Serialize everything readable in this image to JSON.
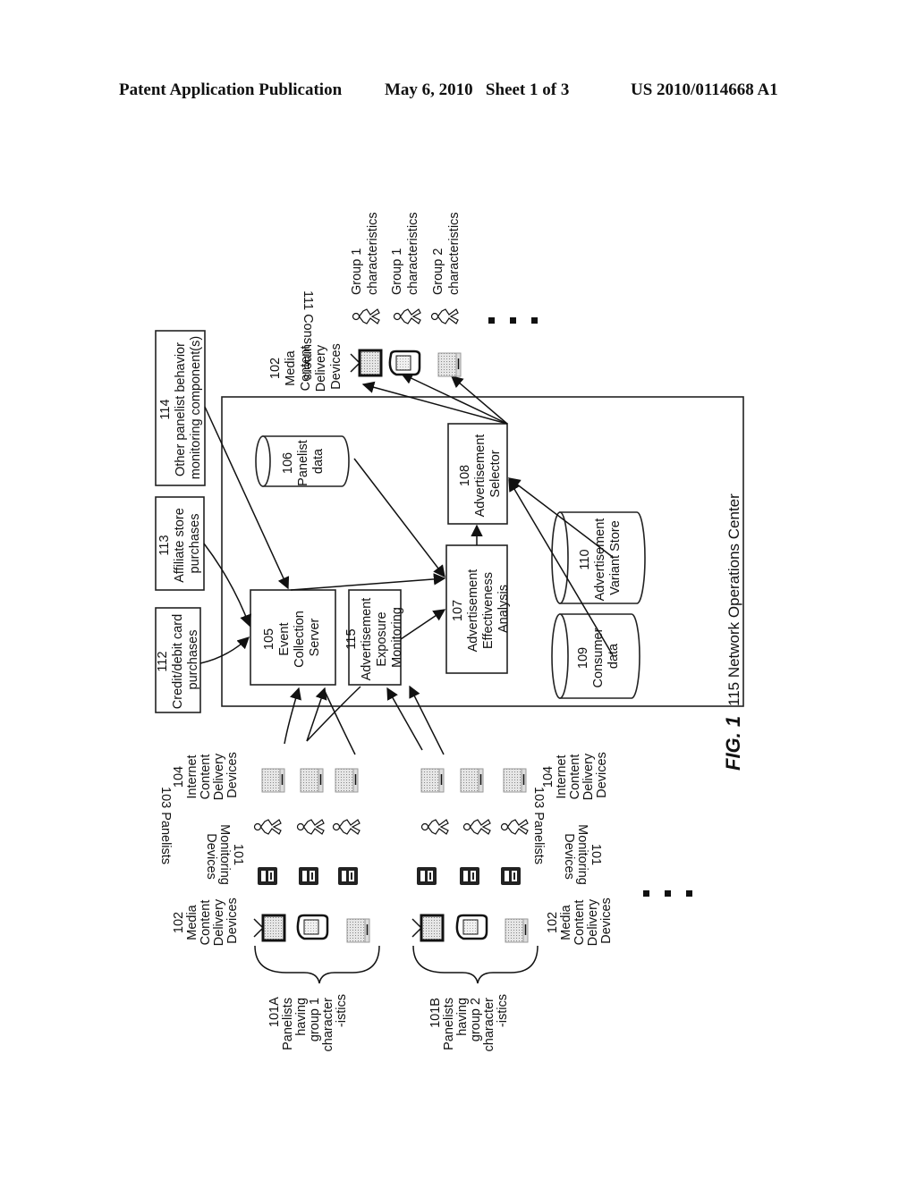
{
  "header": {
    "publication": "Patent Application Publication",
    "date_sheet": "May 6, 2010   Sheet 1 of 3",
    "patent_number": "US 2010/0114668 A1"
  },
  "figure_label": "FIG. 1",
  "noc": {
    "label": "115  Network Operations Center",
    "components": {
      "event_collection": [
        "105",
        "Event",
        "Collection",
        "Server"
      ],
      "exposure_monitoring": [
        "115",
        "Advertisement",
        "Exposure",
        "Monitoring"
      ],
      "effectiveness": [
        "107",
        "Advertisement",
        "Effectiveness",
        "Analysis"
      ],
      "selector": [
        "108",
        "Advertisement",
        "Selector"
      ],
      "panelist_data": [
        "106",
        "Panelist",
        "data"
      ],
      "consumer_data": [
        "109",
        "Consumer",
        "data"
      ],
      "variant_store": [
        "110",
        "Advertisement",
        "Variant Store"
      ]
    }
  },
  "external_inputs": {
    "credit_card": [
      "112",
      "Credit/debit card",
      "purchases"
    ],
    "affiliate": [
      "113",
      "Affiliate store",
      "purchases"
    ],
    "other_monitoring": [
      "114",
      "Other panelist behavior",
      "monitoring component(s)"
    ]
  },
  "consumers_side": {
    "devices_label": [
      "102",
      "Media",
      "Content",
      "Delivery",
      "Devices"
    ],
    "consumers_label": "111 Consumers",
    "characteristics": [
      [
        "Group 1",
        "characteristics"
      ],
      [
        "Group 1",
        "characteristics"
      ],
      [
        "Group 2",
        "characteristics"
      ]
    ]
  },
  "panel_side": {
    "internet_devices_label": [
      "104",
      "Internet",
      "Content",
      "Delivery",
      "Devices"
    ],
    "panelists_label": "103 Panelists",
    "monitoring_label": [
      "101",
      "Monitoring",
      "Devices"
    ],
    "media_devices_label": [
      "102",
      "Media",
      "Content",
      "Delivery",
      "Devices"
    ],
    "group_a": [
      "101A",
      "Panelists",
      "having",
      "group 1",
      "character",
      "-istics"
    ],
    "group_b": [
      "101B",
      "Panelists",
      "having",
      "group 2",
      "character",
      "-istics"
    ]
  }
}
